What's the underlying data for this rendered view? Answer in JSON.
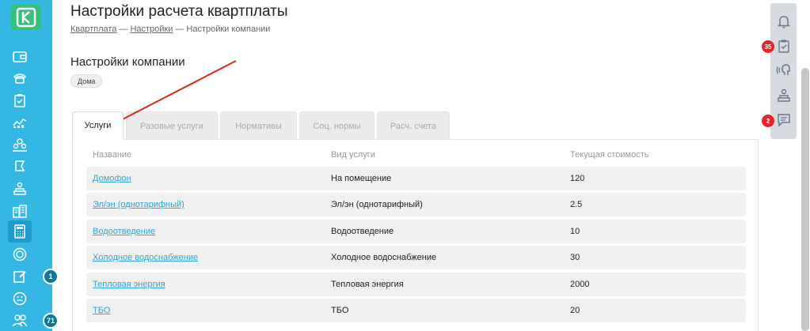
{
  "header": {
    "title": "Настройки расчета квартплаты",
    "breadcrumb": [
      {
        "label": "Квартплата"
      },
      {
        "label": "Настройки"
      },
      {
        "label": "Настройки компании"
      }
    ],
    "breadcrumb_separator": "—"
  },
  "section": {
    "title": "Настройки компании",
    "chip": "Дома"
  },
  "tabs": [
    {
      "label": "Услуги",
      "active": true
    },
    {
      "label": "Разовые услуги",
      "active": false
    },
    {
      "label": "Нормативы",
      "active": false
    },
    {
      "label": "Соц. нормы",
      "active": false
    },
    {
      "label": "Расч. счета",
      "active": false
    }
  ],
  "table": {
    "headers": [
      "Название",
      "Вид услуги",
      "Текущая стоимость"
    ],
    "rows": [
      [
        "Домофон",
        "На помещение",
        "120"
      ],
      [
        "Эл/эн (однотарифный)",
        "Эл/эн (однотарифный)",
        "2.5"
      ],
      [
        "Водоотведение",
        "Водоотведение",
        "10"
      ],
      [
        "Холодное водоснабжение",
        "Холодное водоснабжение",
        "30"
      ],
      [
        "Тепловая энергия",
        "Тепловая энергия",
        "2000"
      ],
      [
        "ТБО",
        "ТБО",
        "20"
      ]
    ]
  },
  "sidebar": {
    "logo_letter": "K",
    "badges": {
      "edit": "1",
      "users": "71"
    },
    "items": [
      {
        "icon": "wallet-icon"
      },
      {
        "icon": "phone-icon"
      },
      {
        "icon": "clipboard-icon"
      },
      {
        "icon": "chart-icon"
      },
      {
        "icon": "people-icon"
      },
      {
        "icon": "flag-icon"
      },
      {
        "icon": "doorman-icon"
      },
      {
        "icon": "buildings-icon"
      },
      {
        "icon": "calculator-icon",
        "active": true
      },
      {
        "icon": "coin-icon"
      },
      {
        "icon": "edit-icon"
      },
      {
        "icon": "smile-icon"
      },
      {
        "icon": "users-icon"
      }
    ]
  },
  "right_rail": {
    "badges": {
      "tasks": "35",
      "messages": "2"
    },
    "items": [
      "bell-icon",
      "tasks-icon",
      "support-icon",
      "doorman-icon",
      "chat-icon"
    ]
  },
  "colors": {
    "sidebar": "#35b7e4",
    "logo": "#34c27a",
    "link": "#2ba8d6",
    "badge_red": "#e32626",
    "arrow": "#e0241b"
  }
}
